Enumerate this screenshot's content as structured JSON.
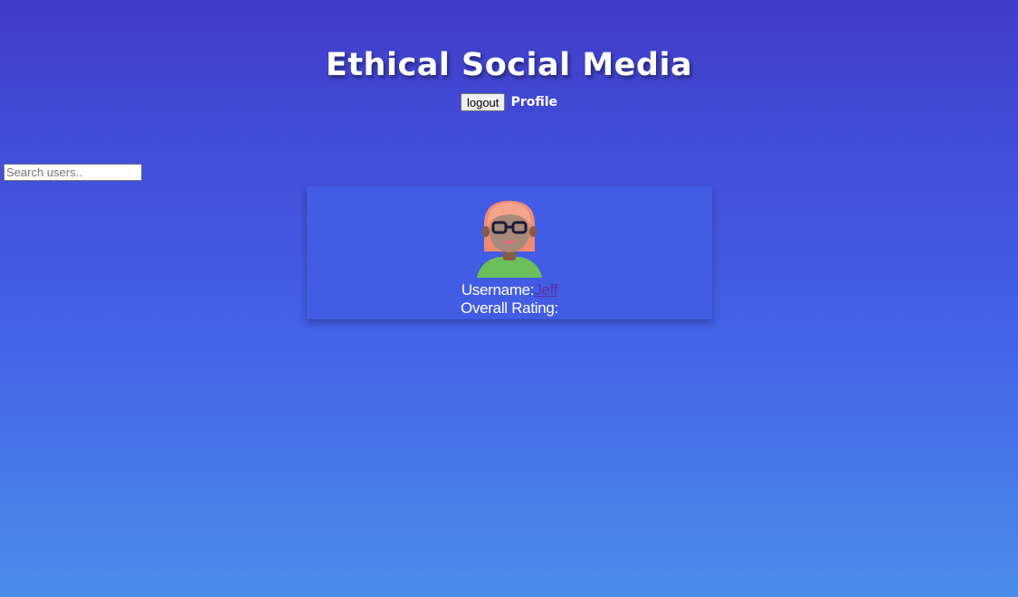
{
  "header": {
    "title": "Ethical Social Media",
    "logout_label": "logout",
    "profile_label": "Profile"
  },
  "search": {
    "placeholder": "Search users.."
  },
  "user_card": {
    "username_label": "Username:",
    "username_value": "Jeff",
    "rating_label": "Overall Rating:",
    "avatar_icon": "person-avatar-icon"
  },
  "colors": {
    "gradient_top": "#3f3dc9",
    "gradient_bottom": "#4a8de8",
    "card_background": "#425ce4",
    "username_link": "#5a2ea6"
  }
}
